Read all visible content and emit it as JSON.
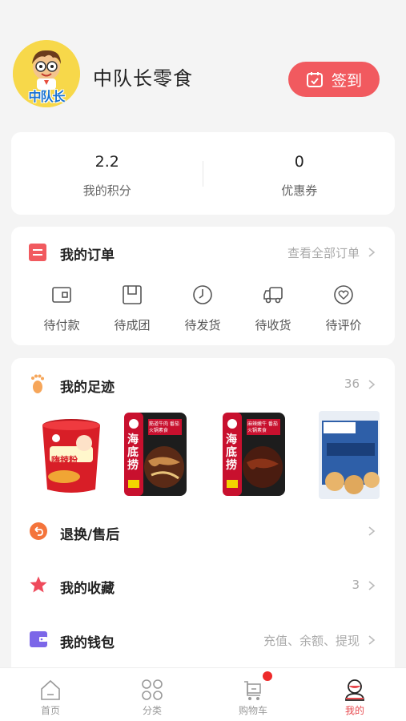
{
  "profile": {
    "shop_name": "中队长零食",
    "avatar_logo_text": "中队长",
    "signin_label": "签到"
  },
  "stats": [
    {
      "value": "2.2",
      "label": "我的积分"
    },
    {
      "value": "0",
      "label": "优惠券"
    }
  ],
  "orders": {
    "title": "我的订单",
    "view_all": "查看全部订单",
    "items": [
      {
        "label": "待付款",
        "icon": "wallet-icon"
      },
      {
        "label": "待成团",
        "icon": "group-icon"
      },
      {
        "label": "待发货",
        "icon": "clock-icon"
      },
      {
        "label": "待收货",
        "icon": "truck-icon"
      },
      {
        "label": "待评价",
        "icon": "heart-icon"
      }
    ]
  },
  "footprint": {
    "title": "我的足迹",
    "count": "36",
    "products": [
      {
        "name": "嗨辣粉",
        "brand": "嗨辣粉"
      },
      {
        "name": "海底捞",
        "sub": "筋道牛肉 番茄火锅素食"
      },
      {
        "name": "海底捞",
        "sub": "麻辣嫩牛 番茄火锅素食"
      },
      {
        "name": "饼干"
      }
    ]
  },
  "after_sales": {
    "title": "退换/售后"
  },
  "favorites": {
    "title": "我的收藏",
    "count": "3"
  },
  "wallet": {
    "title": "我的钱包",
    "actions": "充值、余额、提现"
  },
  "tabbar": [
    {
      "label": "首页",
      "icon": "home-icon"
    },
    {
      "label": "分类",
      "icon": "category-icon"
    },
    {
      "label": "购物车",
      "icon": "cart-icon"
    },
    {
      "label": "我的",
      "icon": "profile-icon"
    }
  ],
  "colors": {
    "accent": "#f15a5f",
    "active_tab": "#e84a4f",
    "badge": "#ee2a2a"
  }
}
